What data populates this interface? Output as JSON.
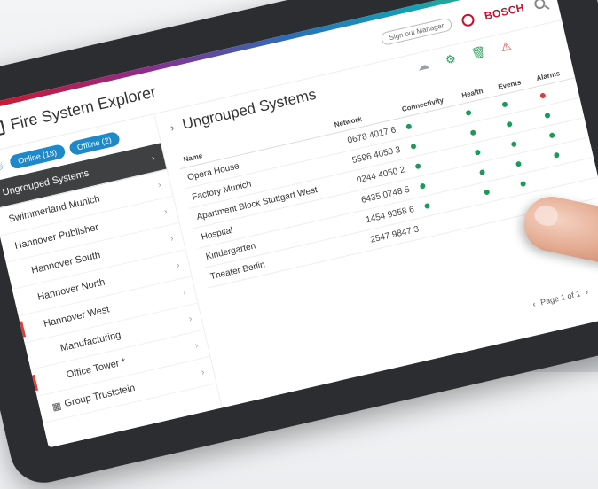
{
  "header": {
    "app_title": "Fire System Explorer",
    "sign_out_label": "Sign out Manager",
    "brand": "BOSCH"
  },
  "sidebar": {
    "pills": [
      "Online (18)",
      "Offline (2)"
    ],
    "items": [
      {
        "label": "Ungrouped Systems",
        "selected": true
      },
      {
        "label": "Swimmerland Munich"
      },
      {
        "label": "Hannover Publisher"
      },
      {
        "label": "Hannover South"
      },
      {
        "label": "Hannover North"
      },
      {
        "label": "Hannover West"
      },
      {
        "label": "Manufacturing"
      },
      {
        "label": "Office Tower *"
      },
      {
        "label": "Group Truststein"
      }
    ]
  },
  "main": {
    "title": "Ungrouped Systems",
    "columns": [
      "Name",
      "Network",
      "Connectivity",
      "Health",
      "Events",
      "Alarms"
    ],
    "rows": [
      {
        "name": "Opera House",
        "network": "0678 4017 6",
        "status": [
          "green",
          "green",
          "green",
          "red"
        ]
      },
      {
        "name": "Factory Munich",
        "network": "5596 4050 3",
        "status": [
          "green",
          "green",
          "green",
          "green"
        ]
      },
      {
        "name": "Apartment Block Stuttgart West",
        "network": "0244 4050 2",
        "status": [
          "green",
          "green",
          "green",
          "green"
        ]
      },
      {
        "name": "Hospital",
        "network": "6435 0748 5",
        "status": [
          "green",
          "green",
          "green",
          "green"
        ]
      },
      {
        "name": "Kindergarten",
        "network": "1454 9358 6",
        "status": [
          "green",
          "green",
          "green",
          ""
        ]
      },
      {
        "name": "Theater Berlin",
        "network": "2547 9847 3",
        "status": [
          "",
          "",
          "",
          ""
        ]
      }
    ],
    "pager": "Page 1 of 1"
  },
  "icons": [
    "cloud-icon",
    "gear-icon",
    "trash-icon",
    "alert-icon"
  ]
}
